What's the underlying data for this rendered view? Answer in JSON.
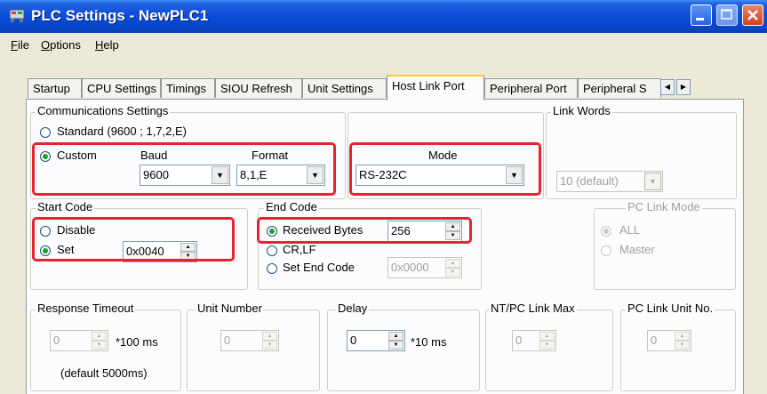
{
  "window": {
    "title": "PLC Settings - NewPLC1"
  },
  "menu": [
    {
      "label": "File",
      "accel": "F",
      "rest": "ile"
    },
    {
      "label": "Options",
      "accel": "O",
      "rest": "ptions"
    },
    {
      "label": "Help",
      "accel": "H",
      "rest": "elp"
    }
  ],
  "tabs": [
    "Startup",
    "CPU Settings",
    "Timings",
    "SIOU Refresh",
    "Unit Settings",
    "Host Link Port",
    "Peripheral Port",
    "Peripheral S"
  ],
  "active_tab": "Host Link Port",
  "comm": {
    "group_label": "Communications Settings",
    "standard_label": "Standard (9600 ; 1,7,2,E)",
    "custom_label": "Custom",
    "baud_label": "Baud",
    "baud_value": "9600",
    "format_label": "Format",
    "format_value": "8,1,E",
    "selected": "custom"
  },
  "mode": {
    "label": "Mode",
    "value": "RS-232C"
  },
  "link_words": {
    "label": "Link Words",
    "value": "10 (default)"
  },
  "start_code": {
    "label": "Start Code",
    "disable_label": "Disable",
    "set_label": "Set",
    "set_value": "0x0040",
    "selected": "set"
  },
  "end_code": {
    "label": "End Code",
    "received_label": "Received Bytes",
    "received_value": "256",
    "crlf_label": "CR,LF",
    "set_end_label": "Set End Code",
    "set_end_value": "0x0000",
    "selected": "received"
  },
  "pc_link_mode": {
    "label": "PC Link Mode",
    "all_label": "ALL",
    "master_label": "Master",
    "selected": "all"
  },
  "response_timeout": {
    "label": "Response Timeout",
    "value": "0",
    "unit": "*100 ms",
    "note": "(default 5000ms)"
  },
  "unit_number": {
    "label": "Unit Number",
    "value": "0"
  },
  "delay": {
    "label": "Delay",
    "value": "0",
    "unit": "*10 ms"
  },
  "nt_pc_link_max": {
    "label": "NT/PC Link Max",
    "value": "0"
  },
  "pc_link_unit_no": {
    "label": "PC Link Unit No.",
    "value": "0"
  },
  "colors": {
    "highlight": "#E8232E",
    "titlebar": "#0A4CD8",
    "dialog_bg": "#ECE9D8"
  }
}
